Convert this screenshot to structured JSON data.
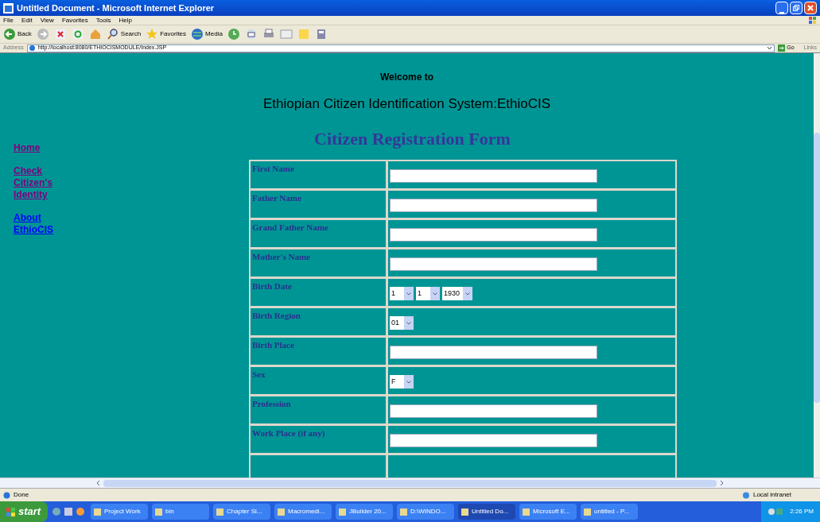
{
  "window": {
    "title": "Untitled Document - Microsoft Internet Explorer"
  },
  "menu": [
    "File",
    "Edit",
    "View",
    "Favorites",
    "Tools",
    "Help"
  ],
  "toolbar": {
    "back": "Back",
    "search": "Search",
    "favorites": "Favorites",
    "media": "Media"
  },
  "address_bar": {
    "label": "Address",
    "url": "http://localhost:8080/ETHIOCISMODULE/Index.JSP",
    "go": "Go",
    "links": "Links"
  },
  "page": {
    "welcome": "Welcome to",
    "system_name": "Ethiopian Citizen Identification System:EthioCIS",
    "form_title": "Citizen Registration Form",
    "nav": [
      {
        "label": "Home",
        "visited": true
      },
      {
        "label": "Check Citizen's Identity",
        "visited": true
      },
      {
        "label": "About EthioCIS",
        "visited": false
      }
    ],
    "form_rows": [
      {
        "label": "First Name",
        "kind": "text"
      },
      {
        "label": "Father Name",
        "kind": "text"
      },
      {
        "label": "Grand Father Name",
        "kind": "text"
      },
      {
        "label": "Mother's Name",
        "kind": "text"
      },
      {
        "label": "Birth Date",
        "kind": "select",
        "values": [
          "1",
          "1",
          "1930"
        ]
      },
      {
        "label": "Birth Region",
        "kind": "select",
        "values": [
          "01"
        ]
      },
      {
        "label": "Birth Place",
        "kind": "text"
      },
      {
        "label": "Sex",
        "kind": "select",
        "values": [
          "F"
        ]
      },
      {
        "label": "Profession",
        "kind": "text"
      },
      {
        "label": "Work Place (if any)",
        "kind": "text"
      }
    ]
  },
  "status_bar": {
    "text": "Done",
    "zone": "Local intranet"
  },
  "taskbar": {
    "start": "start",
    "items": [
      {
        "label": "Project Work",
        "selected": false
      },
      {
        "label": "bin",
        "selected": false
      },
      {
        "label": "Chapter Si...",
        "selected": false
      },
      {
        "label": "Macromedi...",
        "selected": false
      },
      {
        "label": "JBuilder 20...",
        "selected": false
      },
      {
        "label": "D:\\WINDO...",
        "selected": false
      },
      {
        "label": "Untitled Do...",
        "selected": true
      },
      {
        "label": "Microsoft E...",
        "selected": false
      },
      {
        "label": "untitled - P...",
        "selected": false
      }
    ],
    "clock": "2:26 PM"
  }
}
